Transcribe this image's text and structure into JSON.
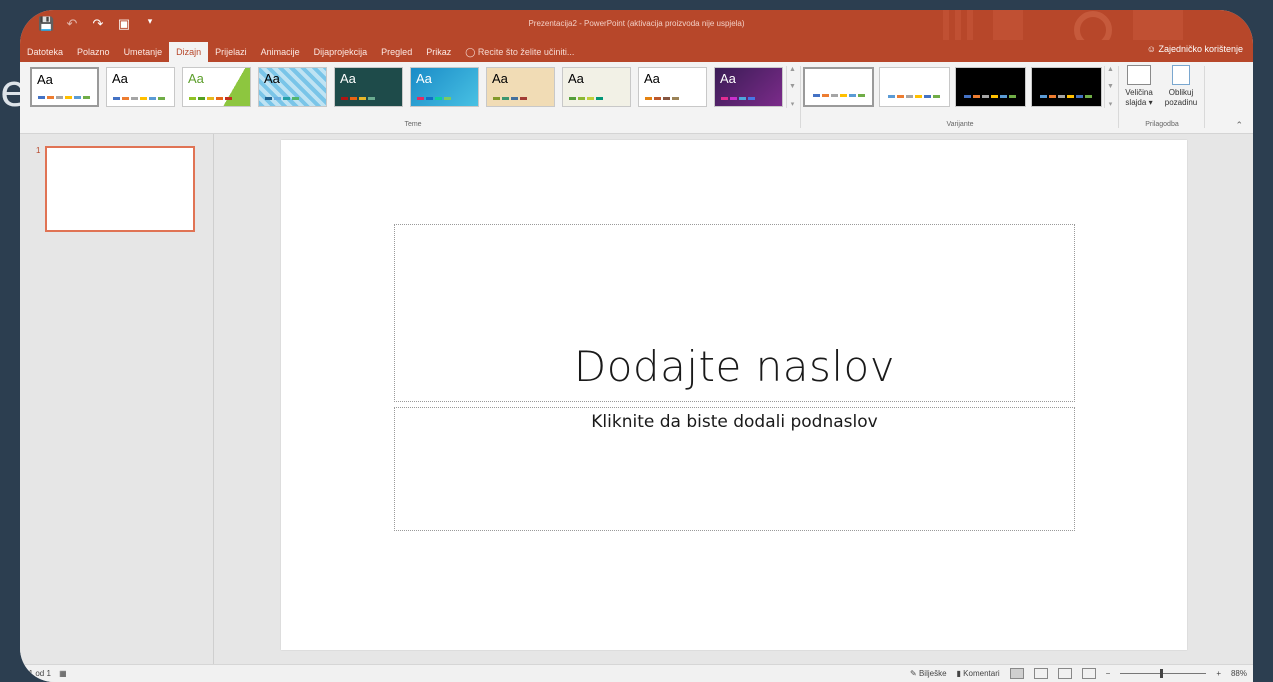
{
  "background": {
    "letter": "e"
  },
  "titlebar": {
    "title": "Prezentacija2 - PowerPoint (aktivacija proizvoda nije uspjela)",
    "qat_icons": [
      "save-icon",
      "undo-icon",
      "redo-icon",
      "start-presentation-icon",
      "customize-icon"
    ]
  },
  "tabs": {
    "items": [
      "Datoteka",
      "Polazno",
      "Umetanje",
      "Dizajn",
      "Prijelazi",
      "Animacije",
      "Dijaprojekcija",
      "Pregled",
      "Prikaz"
    ],
    "active": "Dizajn",
    "tell_me": "Recite što želite učiniti...",
    "share": "Zajedničko korištenje"
  },
  "ribbon": {
    "themes_label": "Teme",
    "variants_label": "Varijante",
    "customize_label": "Prilagodba",
    "theme_aa": "Aa",
    "slide_size_line1": "Veličina",
    "slide_size_line2": "slajda",
    "format_bg_line1": "Oblikuj",
    "format_bg_line2": "pozadinu"
  },
  "thumbs": {
    "slide_number": "1"
  },
  "slide": {
    "title_placeholder": "Dodajte naslov",
    "subtitle_placeholder": "Kliknite da biste dodali podnaslov"
  },
  "statusbar": {
    "slide_counter": "d 1 od 1",
    "notes": "Bilješke",
    "comments": "Komentari",
    "zoom_minus": "−",
    "zoom_plus": "+",
    "zoom": "88%"
  },
  "colors": {
    "accent": "#b7472a",
    "selected_border": "#e07354"
  }
}
